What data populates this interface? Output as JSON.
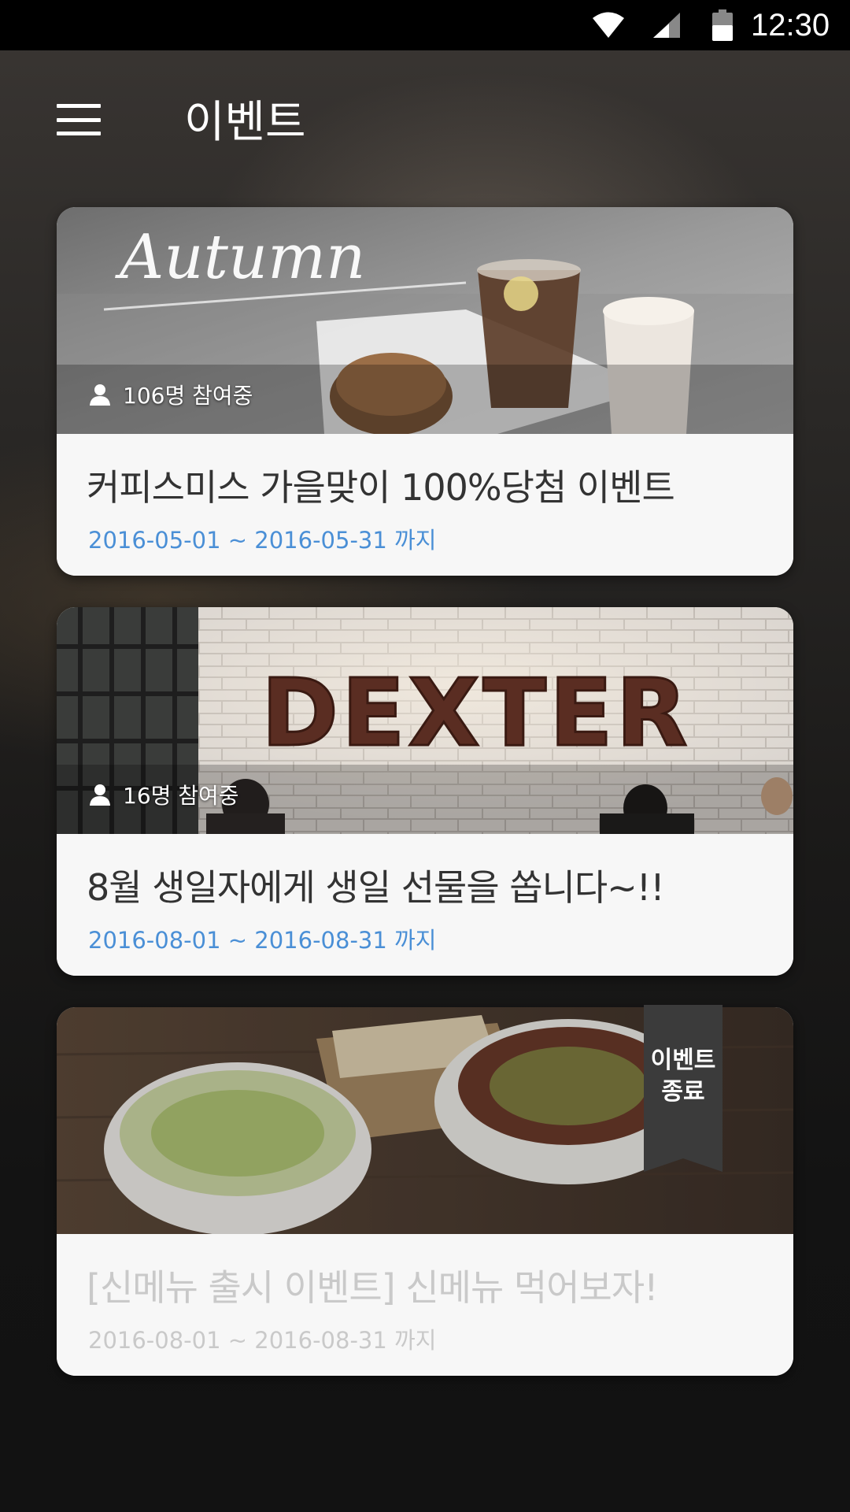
{
  "status_bar": {
    "time": "12:30",
    "icons": [
      "wifi-icon",
      "cell-signal-icon",
      "battery-icon"
    ]
  },
  "app_bar": {
    "menu_icon": "hamburger-menu-icon",
    "title": "이벤트"
  },
  "events": [
    {
      "title": "커피스미스 가을맞이 100%당첨 이벤트",
      "dates": "2016-05-01 ~ 2016-05-31  까지",
      "participants": "106명 참여중",
      "hero_text": "Autumn",
      "ended": false
    },
    {
      "title": "8월 생일자에게 생일 선물을 쏩니다~!!",
      "dates": "2016-08-01 ~ 2016-08-31  까지",
      "participants": "16명 참여중",
      "hero_text": "DEXTER",
      "ended": false
    },
    {
      "title": "[신메뉴 출시 이벤트] 신메뉴 먹어보자!",
      "dates": "2016-08-01 ~ 2016-08-31  까지",
      "participants": "",
      "hero_text": "",
      "ended": true,
      "ended_label_line1": "이벤트",
      "ended_label_line2": "종료"
    }
  ],
  "colors": {
    "date_text": "#4a8fd6",
    "ended_text": "#c9c9c9",
    "ribbon": "#3b3b3b"
  }
}
